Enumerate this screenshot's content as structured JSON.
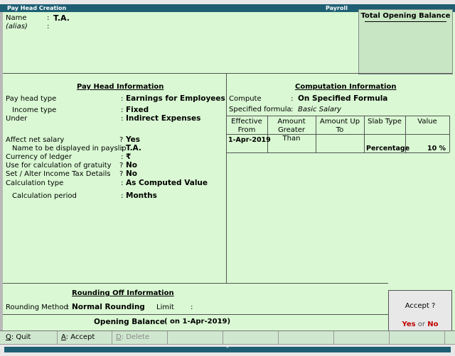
{
  "window": {
    "title": "Pay Head Creation",
    "company_section": "Payroll"
  },
  "header": {
    "name_label": "Name",
    "name_value": "T.A.",
    "alias_label": "(alias)",
    "colon": ":"
  },
  "opening_balance_box": {
    "title": "Total Opening Balance"
  },
  "pay_head_info": {
    "title": "Pay Head Information",
    "fields": [
      {
        "label": "Pay head type",
        "sep": ":",
        "value": "Earnings for Employees"
      },
      {
        "label": "Income type",
        "sep": ":",
        "value": "Fixed"
      },
      {
        "label": "Under",
        "sep": ":",
        "value": "Indirect Expenses"
      },
      {
        "label": "Affect net salary",
        "sep": "?",
        "value": "Yes"
      },
      {
        "label": "Name to be displayed in payslip",
        "sep": ":",
        "value": "T.A."
      },
      {
        "label": "Currency of ledger",
        "sep": ":",
        "value": "₹"
      },
      {
        "label": "Use for calculation of gratuity",
        "sep": "?",
        "value": "No"
      },
      {
        "label": "Set / Alter Income Tax Details",
        "sep": "?",
        "value": "No"
      },
      {
        "label": "Calculation type",
        "sep": ":",
        "value": "As Computed Value"
      },
      {
        "label": "Calculation period",
        "sep": ":",
        "value": "Months"
      }
    ]
  },
  "computation_info": {
    "title": "Computation Information",
    "compute_label": "Compute",
    "compute_value": "On Specified Formula",
    "formula_label": "Specified formula",
    "formula_value": "Basic Salary",
    "columns": [
      "Effective From",
      "Amount Greater Than",
      "Amount Up To",
      "Slab Type",
      "Value"
    ],
    "rows": [
      {
        "effective_from": "1-Apr-2019",
        "greater_than": "",
        "up_to": "",
        "slab_type": "Percentage",
        "value": "10 %"
      }
    ]
  },
  "rounding": {
    "title": "Rounding Off Information",
    "method_label": "Rounding Method",
    "method_value": "Normal Rounding",
    "limit_label": "Limit",
    "sep": ":"
  },
  "opening_balance": {
    "label": "Opening Balance",
    "date_text": "( on 1-Apr-2019)",
    "sep": ":"
  },
  "accept_dialog": {
    "question": "Accept ?",
    "yes": "Yes",
    "or": "or",
    "no": "No"
  },
  "buttons": {
    "quit_key": "Q",
    "quit_label": ": Quit",
    "accept_key": "A",
    "accept_label": ": Accept",
    "delete_key": "D",
    "delete_label": ": Delete"
  },
  "colors": {
    "background": "#d9f8d3",
    "title_bar": "#1e5f73",
    "accept_highlight": "#c00000"
  }
}
